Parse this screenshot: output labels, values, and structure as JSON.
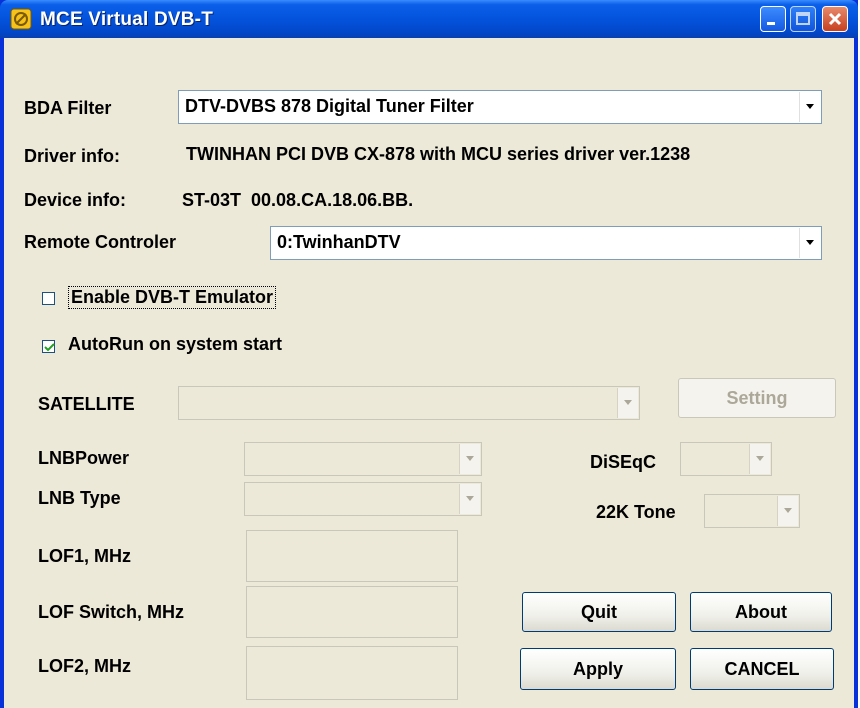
{
  "window": {
    "title": "MCE Virtual DVB-T"
  },
  "bda_filter": {
    "label": "BDA Filter",
    "value": "DTV-DVBS 878 Digital Tuner Filter"
  },
  "driver_info": {
    "label": "Driver info:",
    "value": "TWINHAN PCI DVB CX-878 with MCU series driver ver.1238"
  },
  "device_info": {
    "label": "Device info:",
    "value": "ST-03T  00.08.CA.18.06.BB."
  },
  "remote": {
    "label": "Remote Controler",
    "value": "0:TwinhanDTV"
  },
  "checkboxes": {
    "emulator": {
      "label": "Enable DVB-T Emulator",
      "checked": false
    },
    "autorun": {
      "label": "AutoRun on system start",
      "checked": true
    }
  },
  "satellite": {
    "label": "SATELLITE",
    "value": "",
    "setting_label": "Setting"
  },
  "lnb": {
    "power_label": "LNBPower",
    "type_label": "LNB Type",
    "diseqc_label": "DiSEqC",
    "tone_label": "22K Tone",
    "lof1_label": "LOF1, MHz",
    "lof_switch_label": "LOF Switch, MHz",
    "lof2_label": "LOF2, MHz"
  },
  "buttons": {
    "quit": "Quit",
    "about": "About",
    "apply": "Apply",
    "cancel": "CANCEL"
  },
  "colors": {
    "titlebar": "#0453dd",
    "client": "#ece9d8",
    "close": "#c7401f"
  }
}
